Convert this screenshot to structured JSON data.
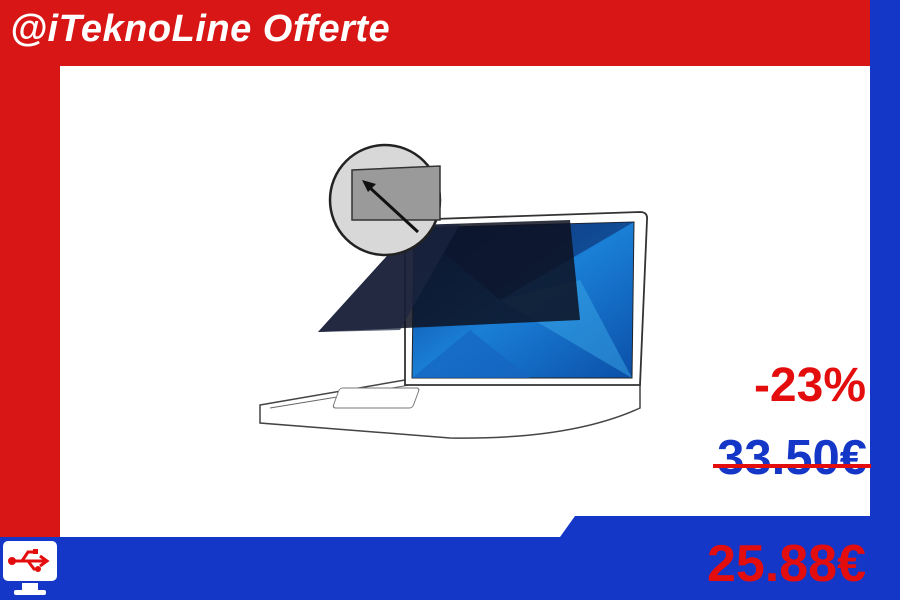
{
  "header": {
    "brand": "@iTeknoLine Offerte"
  },
  "pricing": {
    "discount": "-23%",
    "old_price": "33.50€",
    "new_price": "25.88€"
  },
  "colors": {
    "red": "#d81616",
    "blue": "#1437c8",
    "price_red": "#e40d0d"
  },
  "icons": {
    "logo": "usb-monitor-icon",
    "arrow": "diagonal-arrow-icon"
  }
}
